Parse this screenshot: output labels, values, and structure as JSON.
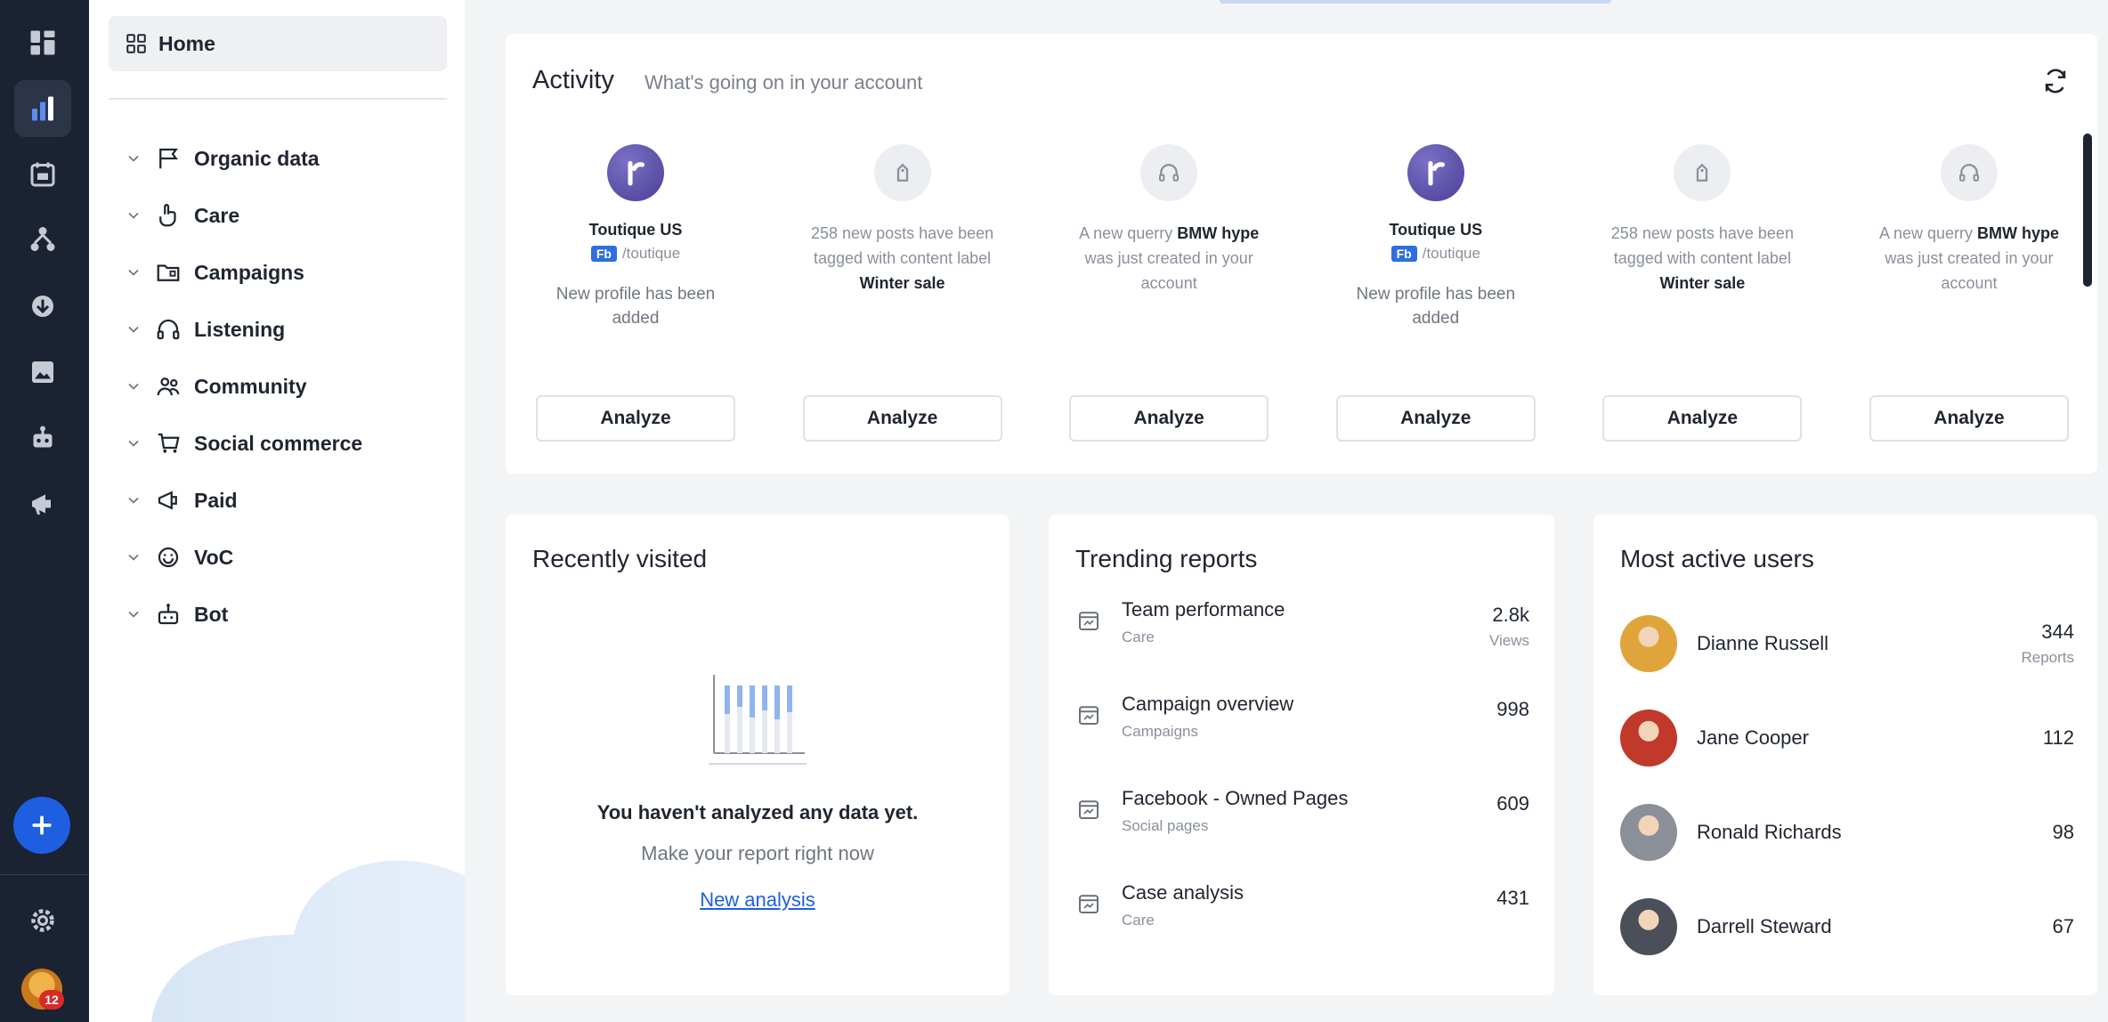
{
  "sidenav": {
    "home_label": "Home",
    "items": [
      {
        "label": "Organic data",
        "icon": "flag-icon"
      },
      {
        "label": "Care",
        "icon": "hand-pointer-icon"
      },
      {
        "label": "Campaigns",
        "icon": "folder-icon"
      },
      {
        "label": "Listening",
        "icon": "headphones-icon"
      },
      {
        "label": "Community",
        "icon": "people-icon"
      },
      {
        "label": "Social commerce",
        "icon": "cart-icon"
      },
      {
        "label": "Paid",
        "icon": "megaphone-icon"
      },
      {
        "label": "VoC",
        "icon": "smile-icon"
      },
      {
        "label": "Bot",
        "icon": "robot-icon"
      }
    ]
  },
  "rail": {
    "icons": [
      "dashboard-icon",
      "analytics-icon",
      "calendar-icon",
      "hierarchy-icon",
      "inbox-icon",
      "image-icon",
      "robot-icon",
      "megaphone-icon"
    ],
    "badge": "12",
    "accent": "#1d5fe0"
  },
  "activity": {
    "title": "Activity",
    "subtitle": "What's going on in your account",
    "analyze_label": "Analyze",
    "items": [
      {
        "type": "profile",
        "name": "Toutique US",
        "tag": "Fb",
        "handle": "/toutique",
        "desc": "New profile has been added"
      },
      {
        "type": "tag",
        "pre": "258 new posts have been tagged with content label ",
        "bold": "Winter sale"
      },
      {
        "type": "query",
        "pre": "A new querry ",
        "bold": "BMW hype",
        "post": " was just created in your account"
      },
      {
        "type": "profile",
        "name": "Toutique US",
        "tag": "Fb",
        "handle": "/toutique",
        "desc": "New profile has been added"
      },
      {
        "type": "tag",
        "pre": "258 new posts have been tagged with content label ",
        "bold": "Winter sale"
      },
      {
        "type": "query",
        "pre": "A new querry ",
        "bold": "BMW hype",
        "post": " was just created in your account"
      }
    ]
  },
  "recent": {
    "title": "Recently visited",
    "empty_title": "You haven't analyzed any data yet.",
    "empty_sub": "Make your report right now",
    "link": "New analysis"
  },
  "trending": {
    "title": "Trending reports",
    "rows": [
      {
        "name": "Team performance",
        "sub": "Care",
        "value": "2.8k",
        "unit": "Views"
      },
      {
        "name": "Campaign overview",
        "sub": "Campaigns",
        "value": "998",
        "unit": ""
      },
      {
        "name": "Facebook - Owned Pages",
        "sub": "Social pages",
        "value": "609",
        "unit": ""
      },
      {
        "name": "Case analysis",
        "sub": "Care",
        "value": "431",
        "unit": ""
      }
    ]
  },
  "users": {
    "title": "Most active users",
    "rows": [
      {
        "name": "Dianne Russell",
        "value": "344",
        "unit": "Reports",
        "color": "#e0a53a"
      },
      {
        "name": "Jane Cooper",
        "value": "112",
        "unit": "",
        "color": "#c0392b"
      },
      {
        "name": "Ronald Richards",
        "value": "98",
        "unit": "",
        "color": "#8a8f99"
      },
      {
        "name": "Darrell Steward",
        "value": "67",
        "unit": "",
        "color": "#4a4f5a"
      }
    ]
  }
}
